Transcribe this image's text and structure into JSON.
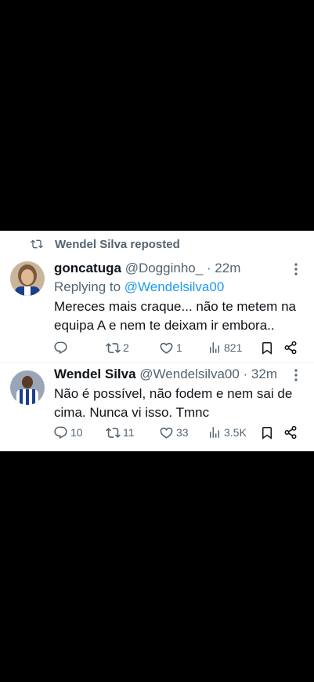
{
  "repost": {
    "label": "Wendel Silva reposted"
  },
  "tweets": [
    {
      "display_name": "goncatuga",
      "handle": "@Dogginho_",
      "time": "· 22m",
      "replying_prefix": "Replying to ",
      "replying_to": "@Wendelsilva00",
      "text_line1": "Mereces mais craque... não te metem na",
      "text_line2": "equipa A e nem te deixam ir embora..",
      "stats": {
        "replies": "",
        "reposts": "2",
        "likes": "1",
        "views": "821"
      }
    },
    {
      "display_name": "Wendel Silva",
      "handle": "@Wendelsilva00",
      "time": "· 32m",
      "text_line1": "Não é possível, não fodem e nem sai de",
      "text_line2": "cima. Nunca vi isso. Tmnc",
      "stats": {
        "replies": "10",
        "reposts": "11",
        "likes": "33",
        "views": "3.5K"
      }
    }
  ],
  "colors": {
    "text": "#0f1419",
    "secondary": "#536471",
    "link": "#1d9bf0",
    "background_outside": "#000000"
  }
}
